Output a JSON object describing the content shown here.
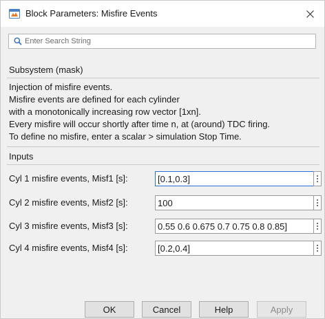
{
  "window": {
    "title": "Block Parameters: Misfire Events",
    "close_icon": "close-icon"
  },
  "search": {
    "placeholder": "Enter Search String",
    "value": ""
  },
  "subsystem": {
    "heading": "Subsystem (mask)",
    "description": [
      "Injection of misfire events.",
      "Misfire events are defined for each cylinder",
      "with a monotonically increasing row vector [1xn].",
      "Every misfire will occur shortly after time n, at (around) TDC firing.",
      "To define no misfire, enter a scalar > simulation Stop Time."
    ]
  },
  "inputs": {
    "heading": "Inputs",
    "params": [
      {
        "label": "Cyl 1 misfire events, Misf1 [s]:",
        "value": "[0.1,0.3]"
      },
      {
        "label": "Cyl 2 misfire events, Misf2 [s]:",
        "value": "100"
      },
      {
        "label": "Cyl 3 misfire events, Misf3 [s]:",
        "value": "0.55 0.6 0.675 0.7 0.75 0.8 0.85]"
      },
      {
        "label": "Cyl 4 misfire events, Misf4 [s]:",
        "value": "[0.2,0.4]"
      }
    ]
  },
  "buttons": {
    "ok": "OK",
    "cancel": "Cancel",
    "help": "Help",
    "apply": "Apply"
  },
  "colors": {
    "dialog_bg": "#f0f0f0",
    "active_border": "#2b6fd6",
    "disabled_text": "#8c8c8c"
  }
}
